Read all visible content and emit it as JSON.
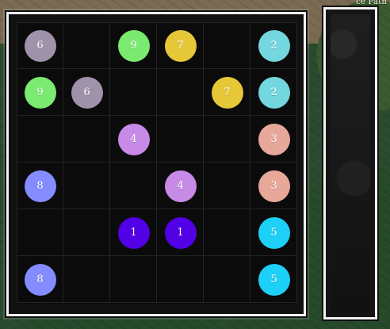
{
  "corner_label": "ce Path",
  "board": {
    "rows": 6,
    "cols": 6,
    "cells": [
      [
        6,
        null,
        9,
        7,
        null,
        2
      ],
      [
        9,
        6,
        null,
        null,
        7,
        2
      ],
      [
        null,
        null,
        4,
        null,
        null,
        3
      ],
      [
        8,
        null,
        null,
        4,
        null,
        3
      ],
      [
        null,
        null,
        1,
        1,
        null,
        5
      ],
      [
        8,
        null,
        null,
        null,
        null,
        5
      ]
    ]
  },
  "colors": {
    "1": "#5200e6",
    "2": "#74d6df",
    "3": "#e8a899",
    "4": "#c78ae6",
    "5": "#1dd0f8",
    "6": "#9f93ac",
    "7": "#e6c738",
    "8": "#858cff",
    "9": "#7bea71"
  },
  "tray": {
    "items": []
  }
}
